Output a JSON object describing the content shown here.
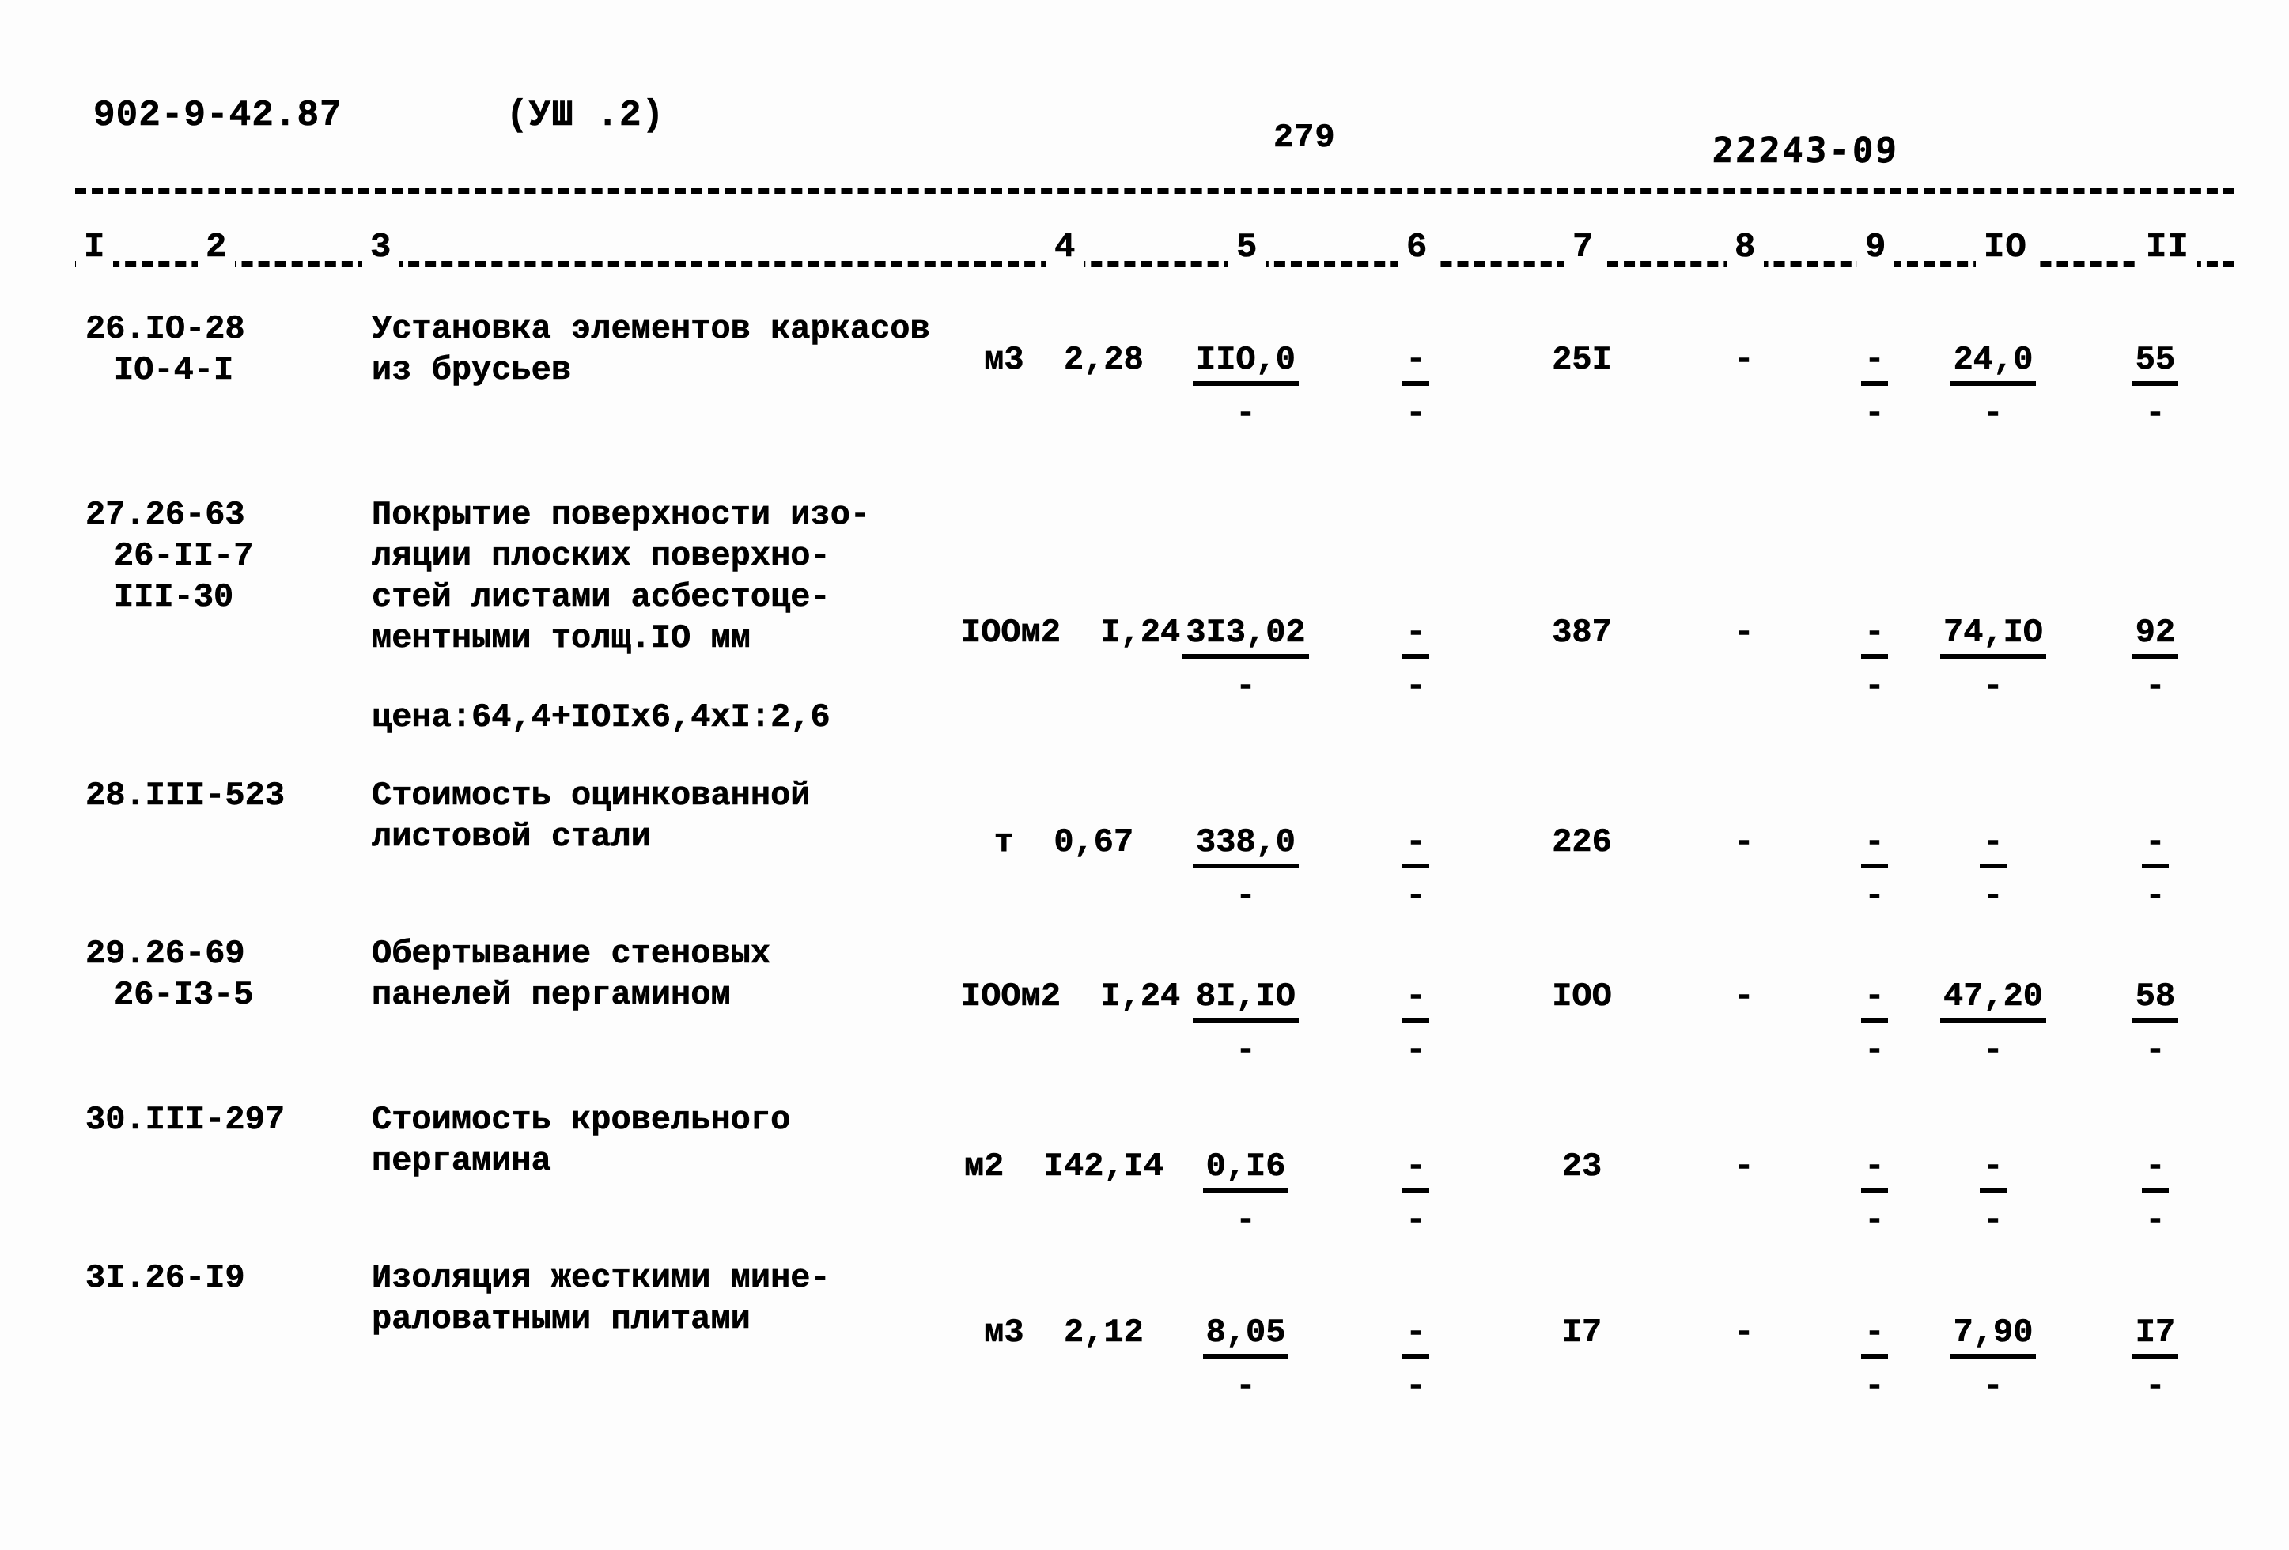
{
  "header": {
    "doc_code": "902-9-42.87",
    "section_ref": "(УШ .2)",
    "page_number": "279",
    "stamp_code": "22243-09"
  },
  "table": {
    "column_headers": [
      "I",
      "2",
      "3",
      "4",
      "5",
      "6",
      "7",
      "8",
      "9",
      "IO",
      "II"
    ],
    "rows": [
      {
        "code_main": "26.IO-28",
        "code_sub1": "IO-4-I",
        "code_sub2": "",
        "code_sub3": "",
        "desc_lines": [
          "Установка элементов каркасов",
          "из брусьев"
        ],
        "price_note": "",
        "unit": "м3",
        "qty": "2,28",
        "c5_top": "IIO,0",
        "c5_bot": "-",
        "c6_top": "-",
        "c6_bot": "-",
        "c7": "25I",
        "c8": "-",
        "c9_top": "-",
        "c9_bot": "-",
        "c10_top": "24,0",
        "c10_bot": "-",
        "c11_top": "55",
        "c11_bot": "-"
      },
      {
        "code_main": "27.26-63",
        "code_sub1": "26-II-7",
        "code_sub2": "III-30",
        "code_sub3": "",
        "desc_lines": [
          "Покрытие поверхности изо-",
          "ляции плоских поверхно-",
          "стей листами асбестоце-",
          "ментными толщ.IO мм"
        ],
        "price_note": "цена:64,4+IOIx6,4xI:2,6",
        "unit": "IOOм2",
        "qty": "I,24",
        "c5_top": "3I3,02",
        "c5_bot": "-",
        "c6_top": "-",
        "c6_bot": "-",
        "c7": "387",
        "c8": "-",
        "c9_top": "-",
        "c9_bot": "-",
        "c10_top": "74,IO",
        "c10_bot": "-",
        "c11_top": "92",
        "c11_bot": "-"
      },
      {
        "code_main": "28.III-523",
        "code_sub1": "",
        "code_sub2": "",
        "code_sub3": "",
        "desc_lines": [
          "Стоимость оцинкованной",
          "листовой стали"
        ],
        "price_note": "",
        "unit": "т",
        "qty": "0,67",
        "c5_top": "338,0",
        "c5_bot": "-",
        "c6_top": "-",
        "c6_bot": "-",
        "c7": "226",
        "c8": "-",
        "c9_top": "-",
        "c9_bot": "-",
        "c10_top": "-",
        "c10_bot": "-",
        "c11_top": "-",
        "c11_bot": "-"
      },
      {
        "code_main": "29.26-69",
        "code_sub1": "26-I3-5",
        "code_sub2": "",
        "code_sub3": "",
        "desc_lines": [
          "Обертывание стеновых",
          "панелей пергамином"
        ],
        "price_note": "",
        "unit": "IOOм2",
        "qty": "I,24",
        "c5_top": "8I,IO",
        "c5_bot": "-",
        "c6_top": "-",
        "c6_bot": "-",
        "c7": "IOO",
        "c8": "-",
        "c9_top": "-",
        "c9_bot": "-",
        "c10_top": "47,20",
        "c10_bot": "-",
        "c11_top": "58",
        "c11_bot": "-"
      },
      {
        "code_main": "30.III-297",
        "code_sub1": "",
        "code_sub2": "",
        "code_sub3": "",
        "desc_lines": [
          "Стоимость кровельного",
          "пергамина"
        ],
        "price_note": "",
        "unit": "м2",
        "qty": "I42,I4",
        "c5_top": "0,I6",
        "c5_bot": "-",
        "c6_top": "-",
        "c6_bot": "-",
        "c7": "23",
        "c8": "-",
        "c9_top": "-",
        "c9_bot": "-",
        "c10_top": "-",
        "c10_bot": "-",
        "c11_top": "-",
        "c11_bot": "-"
      },
      {
        "code_main": "3I.26-I9",
        "code_sub1": "",
        "code_sub2": "",
        "code_sub3": "",
        "desc_lines": [
          "Изоляция жесткими мине-",
          "раловатными плитами"
        ],
        "price_note": "",
        "unit": "м3",
        "qty": "2,12",
        "c5_top": "8,05",
        "c5_bot": "-",
        "c6_top": "-",
        "c6_bot": "-",
        "c7": "I7",
        "c8": "-",
        "c9_top": "-",
        "c9_bot": "-",
        "c10_top": "7,90",
        "c10_bot": "-",
        "c11_top": "I7",
        "c11_bot": "-"
      }
    ]
  }
}
